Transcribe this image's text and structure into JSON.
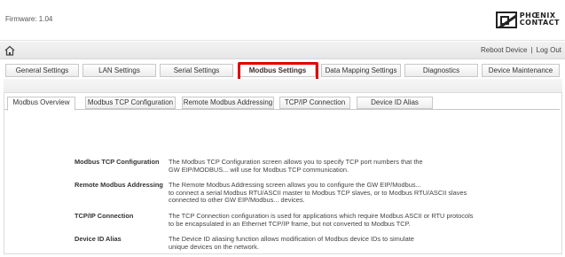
{
  "header": {
    "firmware_label": "Firmware: 1.04",
    "logo_line1": "PHŒNIX",
    "logo_line2": "CONTACT"
  },
  "navbar": {
    "home_icon": "home-icon",
    "reboot_label": "Reboot Device",
    "separator": "|",
    "logout_label": "Log Out"
  },
  "main_tabs": [
    {
      "label": "General Settings"
    },
    {
      "label": "LAN Settings"
    },
    {
      "label": "Serial Settings"
    },
    {
      "label": "Modbus Settings"
    },
    {
      "label": "Data Mapping Settings"
    },
    {
      "label": "Diagnostics"
    },
    {
      "label": "Device Maintenance"
    }
  ],
  "sub_tabs": [
    {
      "label": "Modbus Overview"
    },
    {
      "label": "Modbus TCP Configuration"
    },
    {
      "label": "Remote Modbus Addressing"
    },
    {
      "label": "TCP/IP Connection"
    },
    {
      "label": "Device ID Alias"
    }
  ],
  "overview": [
    {
      "term": "Modbus TCP Configuration",
      "lines": [
        "The Modbus TCP Configuration screen allows you to specify TCP port numbers that the",
        "GW EIP/MODBUS... will use for Modbus TCP communication."
      ]
    },
    {
      "term": "Remote Modbus Addressing",
      "lines": [
        "The Remote Modbus Addressing screen allows you to configure the GW EIP/Modbus...",
        "to connect a serial Modbus RTU/ASCII master to Modbus TCP slaves, or to Modbus RTU/ASCII slaves",
        "connected to other GW EIP/Modbus... devices."
      ]
    },
    {
      "term": "TCP/IP Connection",
      "lines": [
        "The TCP Connection configuration is used for applications which require Modbus ASCII or RTU protocols",
        "to be encapsulated in an Ethernet TCP/IP frame, but not converted to Modbus TCP."
      ]
    },
    {
      "term": "Device ID Alias",
      "lines": [
        "The Device ID aliasing function allows modification of Modbus device IDs to simulate",
        "unique devices on the network."
      ]
    }
  ],
  "colors": {
    "highlight": "#e00000"
  }
}
